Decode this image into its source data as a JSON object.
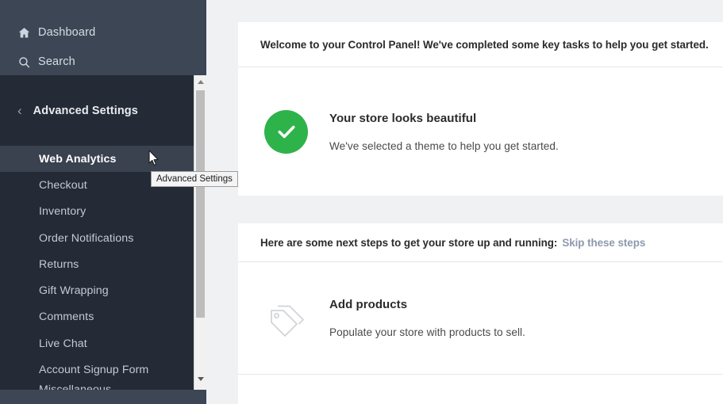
{
  "sidebar": {
    "top_nav": [
      {
        "label": "Dashboard",
        "icon": "home-icon"
      },
      {
        "label": "Search",
        "icon": "search-icon"
      }
    ],
    "panel": {
      "back_icon": "chevron-left-icon",
      "title": "Advanced Settings"
    },
    "menu_items": [
      {
        "label": "Web Analytics",
        "active": true
      },
      {
        "label": "Checkout",
        "active": false
      },
      {
        "label": "Inventory",
        "active": false
      },
      {
        "label": "Order Notifications",
        "active": false
      },
      {
        "label": "Returns",
        "active": false
      },
      {
        "label": "Gift Wrapping",
        "active": false
      },
      {
        "label": "Comments",
        "active": false
      },
      {
        "label": "Live Chat",
        "active": false
      },
      {
        "label": "Account Signup Form",
        "active": false
      },
      {
        "label": "Miscellaneous",
        "active": false
      }
    ],
    "scrollbar": {
      "up_arrow_icon": "scroll-up-arrow-icon",
      "down_arrow_icon": "scroll-down-arrow-icon"
    }
  },
  "tooltip": {
    "text": "Advanced Settings"
  },
  "cursor": {
    "icon": "mouse-pointer-icon"
  },
  "main": {
    "welcome_banner": "Welcome to your Control Panel! We've completed some key tasks to help you get started.",
    "completed_task": {
      "status_icon": "green-check-circle-icon",
      "title": "Your store looks beautiful",
      "description": "We've selected a theme to help you get started."
    },
    "next_steps": {
      "heading": "Here are some next steps to get your store up and running:",
      "skip_link": "Skip these steps"
    },
    "steps": [
      {
        "icon": "price-tag-icon",
        "title": "Add products",
        "description": "Populate your store with products to sell."
      }
    ]
  },
  "colors": {
    "sidebar_top": "#3c4655",
    "sidebar_panel": "#252b36",
    "sidebar_active": "#3a4250",
    "accent_green": "#2eb34a",
    "link_gray_blue": "#8d99ac",
    "page_background": "#f0f1f3"
  }
}
